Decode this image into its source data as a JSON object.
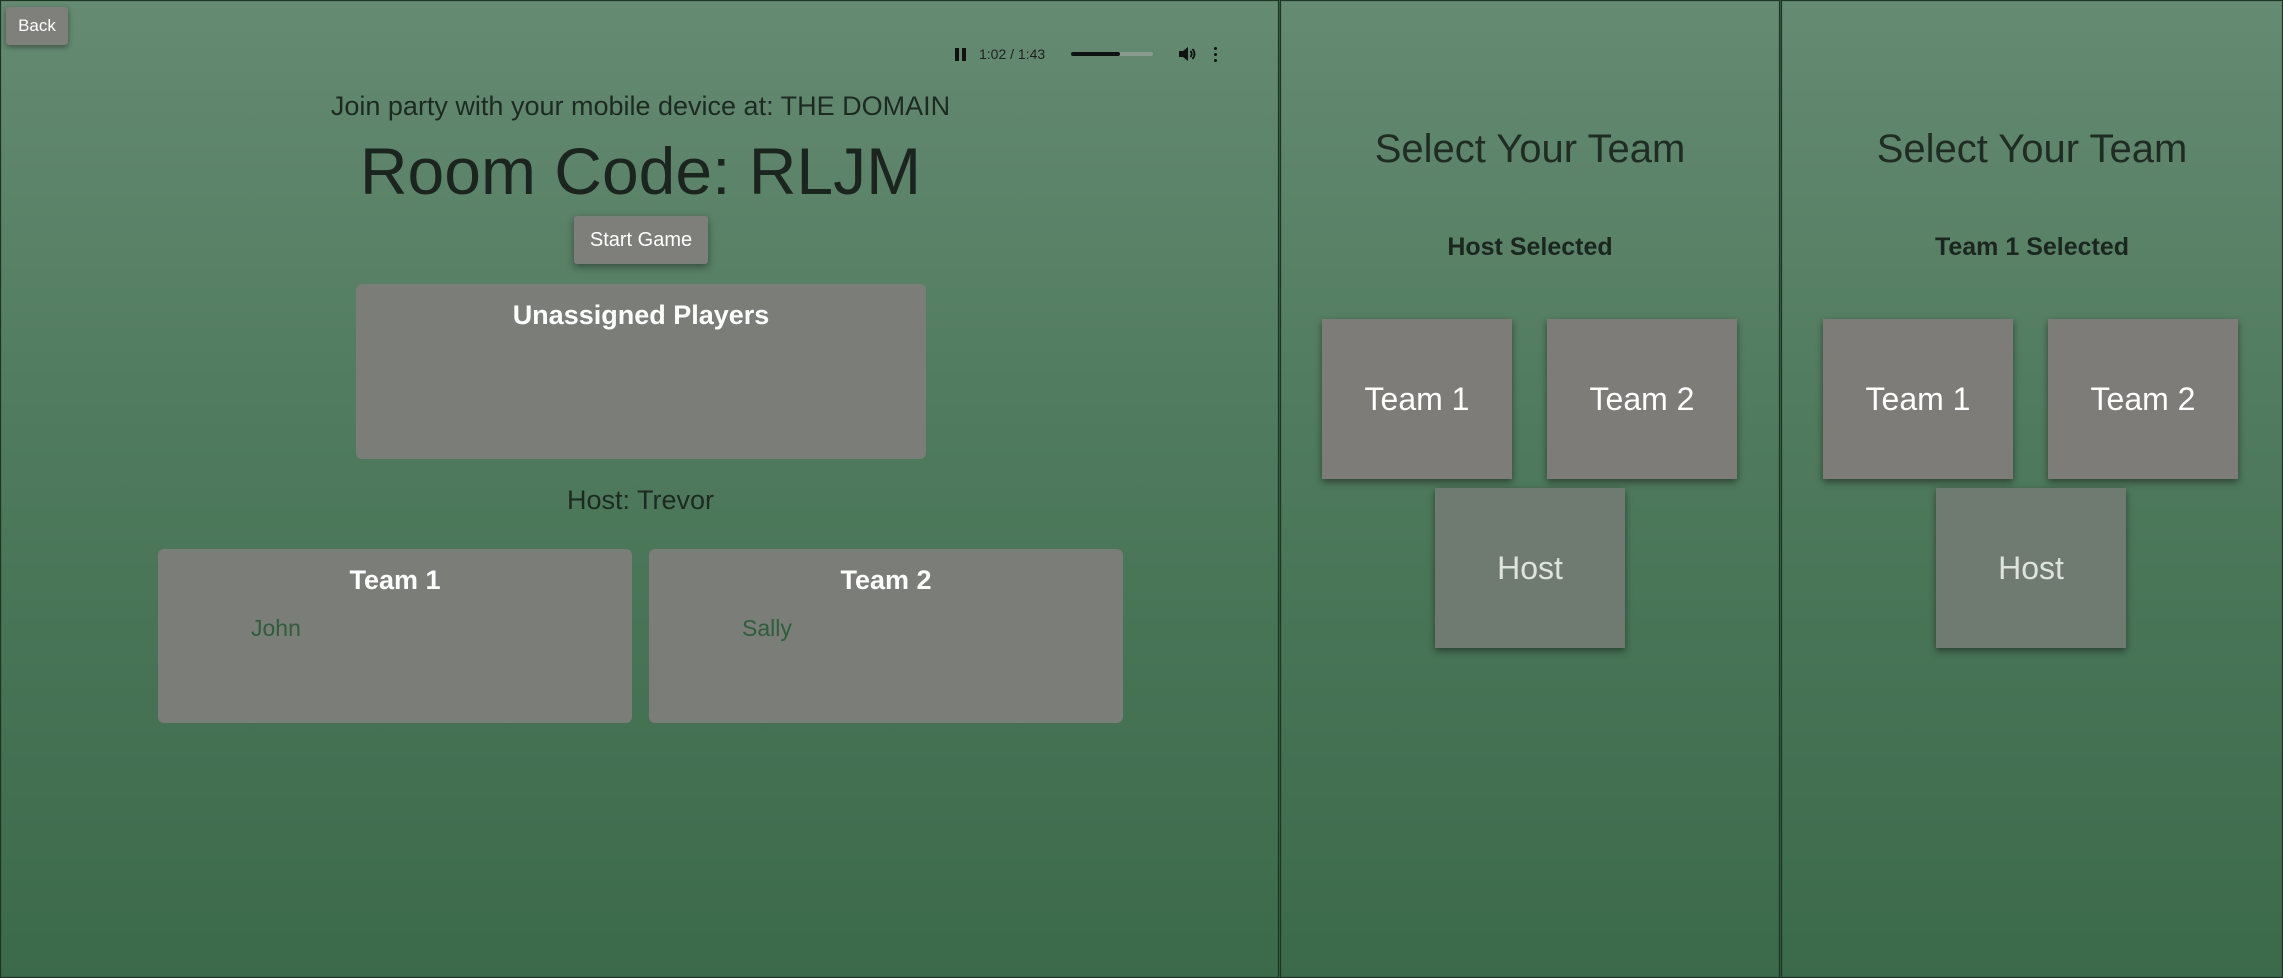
{
  "host_screen": {
    "back_label": "Back",
    "audio": {
      "time": "1:02 / 1:43",
      "progress": 0.6
    },
    "join_text": "Join party with your mobile device at: THE DOMAIN",
    "room_code": "Room Code: RLJM",
    "start_label": "Start Game",
    "unassigned_title": "Unassigned Players",
    "host_label": "Host: Trevor",
    "teams": [
      {
        "name": "Team 1",
        "players": [
          "John"
        ]
      },
      {
        "name": "Team 2",
        "players": [
          "Sally"
        ]
      }
    ]
  },
  "phones": [
    {
      "title": "Select Your Team",
      "status": "Host Selected",
      "buttons": [
        "Team 1",
        "Team 2",
        "Host"
      ]
    },
    {
      "title": "Select Your Team",
      "status": "Team 1 Selected",
      "buttons": [
        "Team 1",
        "Team 2",
        "Host"
      ]
    }
  ],
  "colors": {
    "panel_top": "#658b73",
    "panel_bottom": "#3b6a4a",
    "button_gray": "#7d7c79",
    "player_green": "#2e5e3b"
  }
}
